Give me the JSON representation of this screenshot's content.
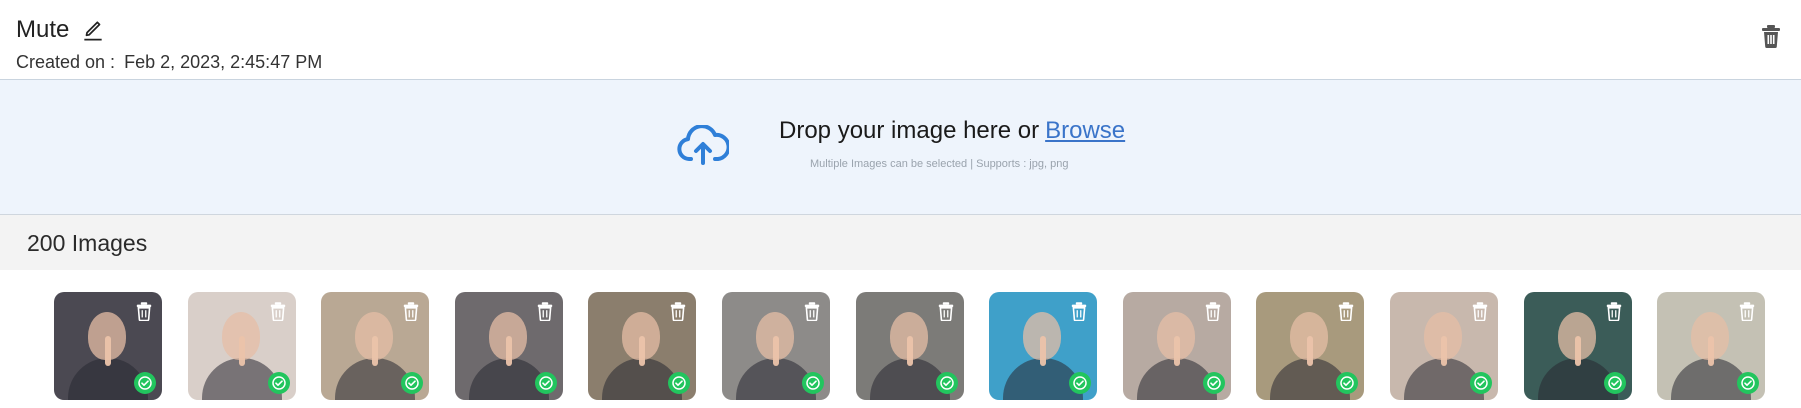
{
  "header": {
    "title": "Mute",
    "created_label": "Created on :",
    "created_value": "Feb 2, 2023, 2:45:47 PM"
  },
  "upload": {
    "prompt": "Drop your image here or",
    "browse_label": "Browse",
    "hint": "Multiple Images can be selected | Supports : jpg, png"
  },
  "gallery": {
    "count_label": "200 Images",
    "thumbnails": [
      {
        "bg": "#4b4952"
      },
      {
        "bg": "#d9cfc9"
      },
      {
        "bg": "#b9a894"
      },
      {
        "bg": "#6e6a6d"
      },
      {
        "bg": "#8b7e6d"
      },
      {
        "bg": "#8d8b89"
      },
      {
        "bg": "#7c7b78"
      },
      {
        "bg": "#3fa0c9"
      },
      {
        "bg": "#b7aaa2"
      },
      {
        "bg": "#a89a7d"
      },
      {
        "bg": "#c8b8ad"
      },
      {
        "bg": "#3b5c58"
      },
      {
        "bg": "#c4c1b4"
      }
    ]
  },
  "colors": {
    "accent": "#3a74c9",
    "success": "#22c55e",
    "dropzone_bg": "#eef4fc"
  },
  "icons": {
    "edit": "pencil-icon",
    "delete": "trash-icon",
    "upload": "cloud-upload-icon",
    "selected": "check-circle-icon"
  }
}
